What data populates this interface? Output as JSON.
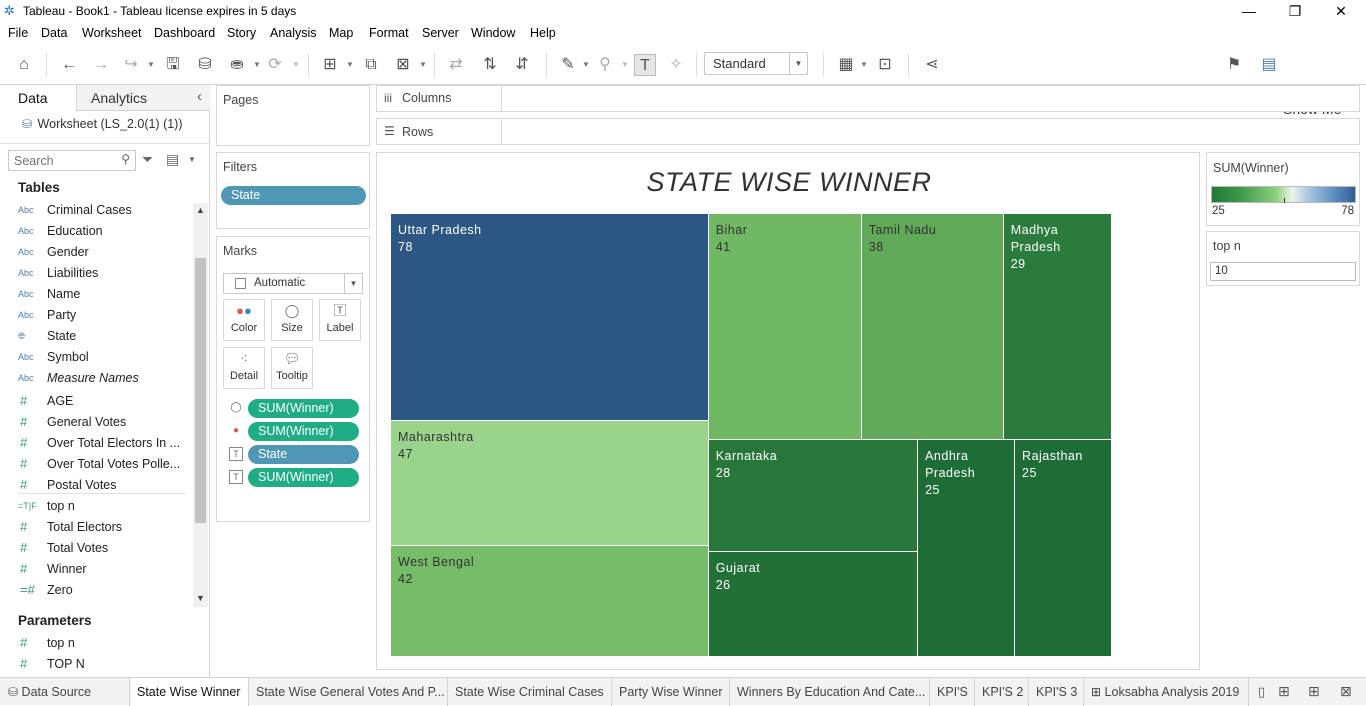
{
  "window": {
    "title": "Tableau - Book1 - Tableau license expires in 5 days",
    "minimize": "—",
    "restore": "❐",
    "close": "✕"
  },
  "menu": [
    "File",
    "Data",
    "Worksheet",
    "Dashboard",
    "Story",
    "Analysis",
    "Map",
    "Format",
    "Server",
    "Window",
    "Help"
  ],
  "toolbar": {
    "fit_select": "Standard",
    "show_me": "Show Me"
  },
  "data_pane": {
    "tab_data": "Data",
    "tab_analytics": "Analytics",
    "collapse": "‹",
    "datasource": "Worksheet (LS_2.0(1) (1))",
    "search_placeholder": "Search",
    "tables_heading": "Tables",
    "dimensions": [
      {
        "type": "Abc",
        "name": "Criminal Cases"
      },
      {
        "type": "Abc",
        "name": "Education"
      },
      {
        "type": "Abc",
        "name": "Gender"
      },
      {
        "type": "Abc",
        "name": "Liabilities"
      },
      {
        "type": "Abc",
        "name": "Name"
      },
      {
        "type": "Abc",
        "name": "Party"
      },
      {
        "type": "globe",
        "name": "State"
      },
      {
        "type": "Abc",
        "name": "Symbol"
      },
      {
        "type": "Abc",
        "name": "Measure Names"
      }
    ],
    "measures": [
      {
        "type": "#",
        "name": "AGE"
      },
      {
        "type": "#",
        "name": "General Votes"
      },
      {
        "type": "#",
        "name": "Over Total Electors  In ..."
      },
      {
        "type": "#",
        "name": "Over Total Votes Polle..."
      },
      {
        "type": "#",
        "name": "Postal Votes"
      },
      {
        "type": "=T|F",
        "name": "top n"
      },
      {
        "type": "#",
        "name": "Total Electors"
      },
      {
        "type": "#",
        "name": "Total Votes"
      },
      {
        "type": "#",
        "name": "Winner"
      },
      {
        "type": "=#",
        "name": "Zero"
      }
    ],
    "parameters_heading": "Parameters",
    "parameters": [
      {
        "type": "#",
        "name": "top n"
      },
      {
        "type": "#",
        "name": "TOP N"
      }
    ]
  },
  "shelves": {
    "pages": "Pages",
    "columns": "Columns",
    "rows": "Rows",
    "filters": "Filters",
    "filter_pills": [
      "State"
    ],
    "marks": "Marks",
    "mark_type": "Automatic",
    "mark_buttons": [
      "Color",
      "Size",
      "Label",
      "Detail",
      "Tooltip"
    ],
    "mark_pills": [
      {
        "kind": "size",
        "label": "SUM(Winner)",
        "color": "green"
      },
      {
        "kind": "color",
        "label": "SUM(Winner)",
        "color": "green"
      },
      {
        "kind": "label",
        "label": "State",
        "color": "blue"
      },
      {
        "kind": "label",
        "label": "SUM(Winner)",
        "color": "green"
      }
    ]
  },
  "chart_data": {
    "type": "treemap",
    "title": "STATE WISE WINNER",
    "measure": "SUM(Winner)",
    "categories": [
      "Uttar Pradesh",
      "Maharashtra",
      "West Bengal",
      "Bihar",
      "Tamil Nadu",
      "Madhya Pradesh",
      "Karnataka",
      "Gujarat",
      "Andhra Pradesh",
      "Rajasthan"
    ],
    "values": [
      78,
      47,
      42,
      41,
      38,
      29,
      28,
      26,
      25,
      25
    ],
    "color_scale": {
      "min": 25,
      "max": 78
    }
  },
  "legend": {
    "title": "SUM(Winner)",
    "min_label": "25",
    "max_label": "78"
  },
  "topn_card": {
    "title": "top n",
    "value": "10"
  },
  "sheet_tabs": {
    "data_source": "Data Source",
    "tabs": [
      "State Wise Winner",
      "State Wise General Votes And P...",
      "State Wise Criminal Cases",
      "Party Wise Winner",
      "Winners By Education And Cate...",
      "KPI'S",
      "KPI'S 2",
      "KPI'S 3",
      "Loksabha Analysis 2019"
    ]
  }
}
